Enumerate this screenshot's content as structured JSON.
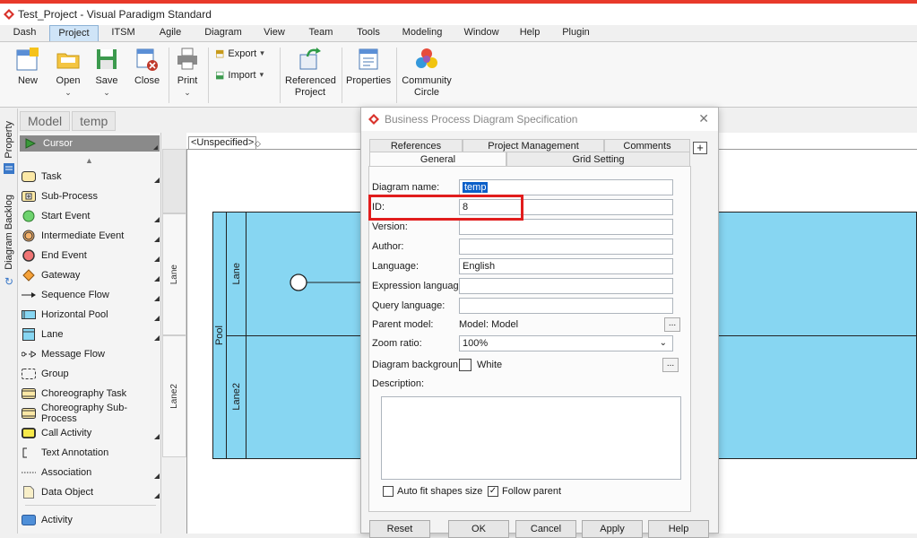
{
  "window": {
    "title": "Test_Project - Visual Paradigm Standard"
  },
  "menu": [
    "Dash",
    "Project",
    "ITSM",
    "Agile",
    "Diagram",
    "View",
    "Team",
    "Tools",
    "Modeling",
    "Window",
    "Help",
    "Plugin"
  ],
  "ribbon": {
    "new": "New",
    "open": "Open",
    "save": "Save",
    "close": "Close",
    "print": "Print",
    "export": "Export",
    "import": "Import",
    "referenced_line1": "Referenced",
    "referenced_line2": "Project",
    "properties": "Properties",
    "community_line1": "Community",
    "community_line2": "Circle"
  },
  "side_tabs": {
    "property": "Property",
    "diagram_backlog": "Diagram Backlog"
  },
  "breadcrumb": [
    "Model",
    "temp"
  ],
  "palette": {
    "cursor": "Cursor",
    "items": [
      "Task",
      "Sub-Process",
      "Start Event",
      "Intermediate Event",
      "End Event",
      "Gateway",
      "Sequence Flow",
      "Horizontal Pool",
      "Lane",
      "Message Flow",
      "Group",
      "Choreography Task",
      "Choreography Sub-Process",
      "Call Activity",
      "Text Annotation",
      "Association",
      "Data Object",
      "Activity"
    ]
  },
  "canvas": {
    "unspecified": "<Unspecified>",
    "strip_lane1": "Lane",
    "strip_lane2": "Lane2",
    "pool": "Pool",
    "lane1": "Lane",
    "lane2": "Lane2"
  },
  "dialog": {
    "title": "Business Process Diagram Specification",
    "tabs_back": [
      "References",
      "Project Management",
      "Comments"
    ],
    "tabs_front": [
      "General",
      "Grid Setting"
    ],
    "fields": {
      "diagram_name_label": "Diagram name:",
      "diagram_name": "temp",
      "id_label": "ID:",
      "id": "8",
      "version_label": "Version:",
      "version": "",
      "author_label": "Author:",
      "author": "",
      "language_label": "Language:",
      "language": "English",
      "expression_label": "Expression languag...",
      "expression": "",
      "query_label": "Query language:",
      "query": "",
      "parent_label": "Parent model:",
      "parent": "Model: Model",
      "zoom_label": "Zoom ratio:",
      "zoom": "100%",
      "background_label": "Diagram backgroun...",
      "background": "White",
      "description_label": "Description:"
    },
    "auto_fit": "Auto fit shapes size",
    "follow_parent": "Follow parent",
    "buttons": {
      "reset": "Reset",
      "ok": "OK",
      "cancel": "Cancel",
      "apply": "Apply",
      "help": "Help"
    }
  },
  "colors": {
    "accent": "#e8392a",
    "pool": "#87d6f2",
    "highlight": "#e11d1d",
    "selection": "#0b5fc8"
  }
}
